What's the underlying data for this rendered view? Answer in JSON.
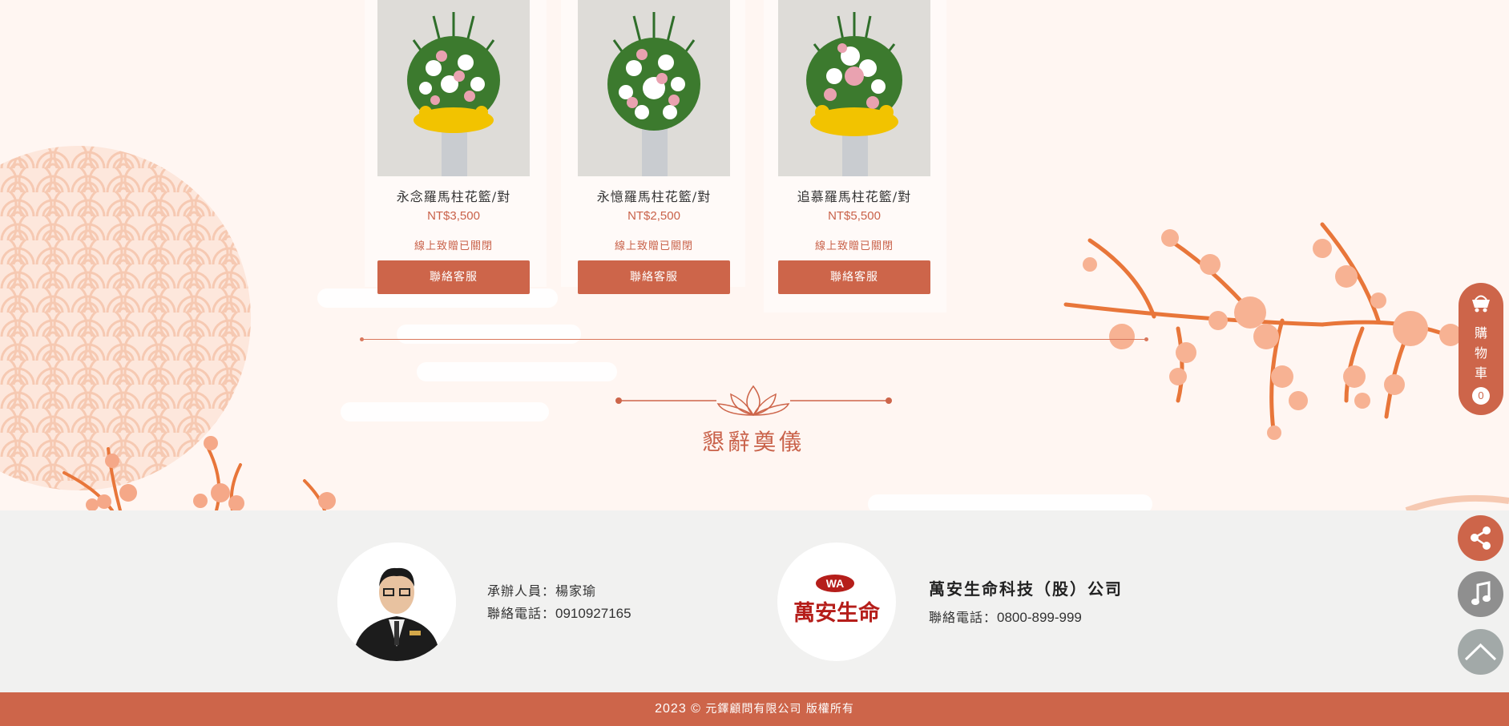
{
  "products": [
    {
      "name": "永念羅馬柱花籃/對",
      "price": "NT$3,500",
      "status": "線上致贈已關閉",
      "button": "聯絡客服"
    },
    {
      "name": "永憶羅馬柱花籃/對",
      "price": "NT$2,500",
      "status": "線上致贈已關閉",
      "button": "聯絡客服"
    },
    {
      "name": "追慕羅馬柱花籃/對",
      "price": "NT$5,500",
      "status": "線上致贈已關閉",
      "button": "聯絡客服"
    }
  ],
  "section": {
    "title": "懇辭奠儀"
  },
  "contact": {
    "staff_line": "承辦人員：楊家瑜",
    "staff_phone_label": "聯絡電話：",
    "staff_phone": "0910927165"
  },
  "company": {
    "name": "萬安生命科技（股）公司",
    "phone_label": "聯絡電話：",
    "phone": "0800-899-999",
    "logo_badge": "WA",
    "logo_text": "萬安生命"
  },
  "cart": {
    "label": "購物車",
    "count": "0"
  },
  "footer": {
    "year": "2023 ©",
    "text": "元鐸顧問有限公司 版權所有"
  },
  "colors": {
    "accent": "#cd654a",
    "background": "#fff6f2",
    "footer_bg": "#f1f1f0"
  },
  "icons": [
    "cart-icon",
    "share-icon",
    "music-icon",
    "back-to-top-icon",
    "lotus-icon"
  ]
}
